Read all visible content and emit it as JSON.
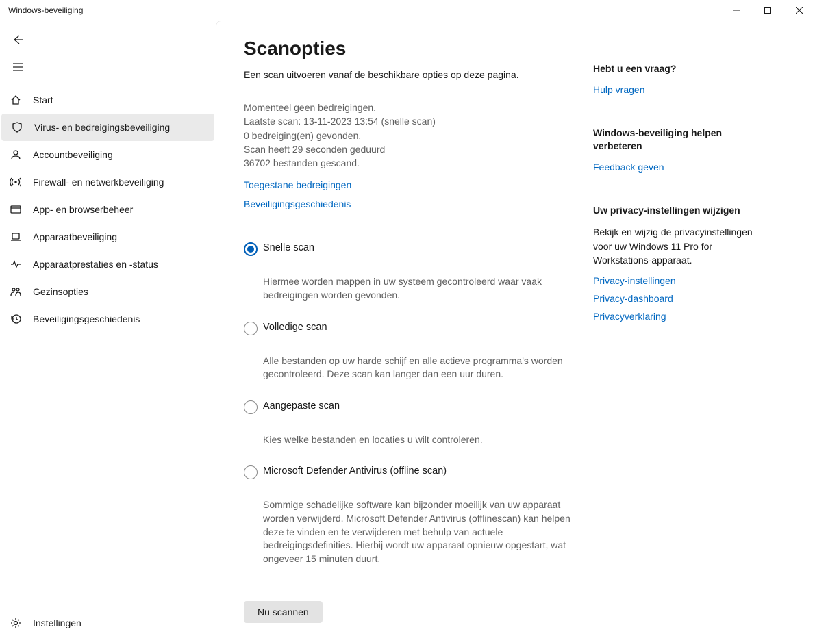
{
  "window": {
    "title": "Windows-beveiliging"
  },
  "sidebar": {
    "items": [
      {
        "label": "Start"
      },
      {
        "label": "Virus- en bedreigingsbeveiliging"
      },
      {
        "label": "Accountbeveiliging"
      },
      {
        "label": "Firewall- en netwerkbeveiliging"
      },
      {
        "label": "App- en browserbeheer"
      },
      {
        "label": "Apparaatbeveiliging"
      },
      {
        "label": "Apparaatprestaties en -status"
      },
      {
        "label": "Gezinsopties"
      },
      {
        "label": "Beveiligingsgeschiedenis"
      }
    ],
    "settings_label": "Instellingen"
  },
  "page": {
    "title": "Scanopties",
    "subtitle": "Een scan uitvoeren vanaf de beschikbare opties op deze pagina.",
    "status": {
      "line1": "Momenteel geen bedreigingen.",
      "line2": "Laatste scan: 13-11-2023 13:54 (snelle scan)",
      "line3": "0 bedreiging(en) gevonden.",
      "line4": "Scan heeft 29 seconden  geduurd",
      "line5": "36702 bestanden gescand."
    },
    "links": {
      "allowed_threats": "Toegestane bedreigingen",
      "protection_history": "Beveiligingsgeschiedenis"
    },
    "options": [
      {
        "label": "Snelle scan",
        "desc": "Hiermee worden mappen in uw systeem gecontroleerd waar vaak bedreigingen worden gevonden.",
        "checked": true
      },
      {
        "label": "Volledige scan",
        "desc": "Alle bestanden op uw harde schijf en alle actieve programma's worden gecontroleerd. Deze scan kan langer dan een uur duren.",
        "checked": false
      },
      {
        "label": "Aangepaste scan",
        "desc": "Kies welke bestanden en locaties u wilt controleren.",
        "checked": false
      },
      {
        "label": "Microsoft Defender Antivirus (offline scan)",
        "desc": "Sommige schadelijke software kan bijzonder moeilijk van uw apparaat worden verwijderd. Microsoft Defender Antivirus (offlinescan) kan helpen deze te vinden en te verwijderen met behulp van actuele bedreigingsdefinities. Hierbij wordt uw apparaat opnieuw opgestart, wat ongeveer 15 minuten duurt.",
        "checked": false
      }
    ],
    "scan_button": "Nu scannen"
  },
  "side": {
    "help": {
      "heading": "Hebt u een vraag?",
      "link": "Hulp vragen"
    },
    "improve": {
      "heading": "Windows-beveiliging helpen verbeteren",
      "link": "Feedback geven"
    },
    "privacy": {
      "heading": "Uw privacy-instellingen wijzigen",
      "text": "Bekijk en wijzig de privacyinstellingen voor uw Windows 11 Pro for Workstations-apparaat.",
      "link1": "Privacy-instellingen",
      "link2": "Privacy-dashboard",
      "link3": "Privacyverklaring"
    }
  }
}
